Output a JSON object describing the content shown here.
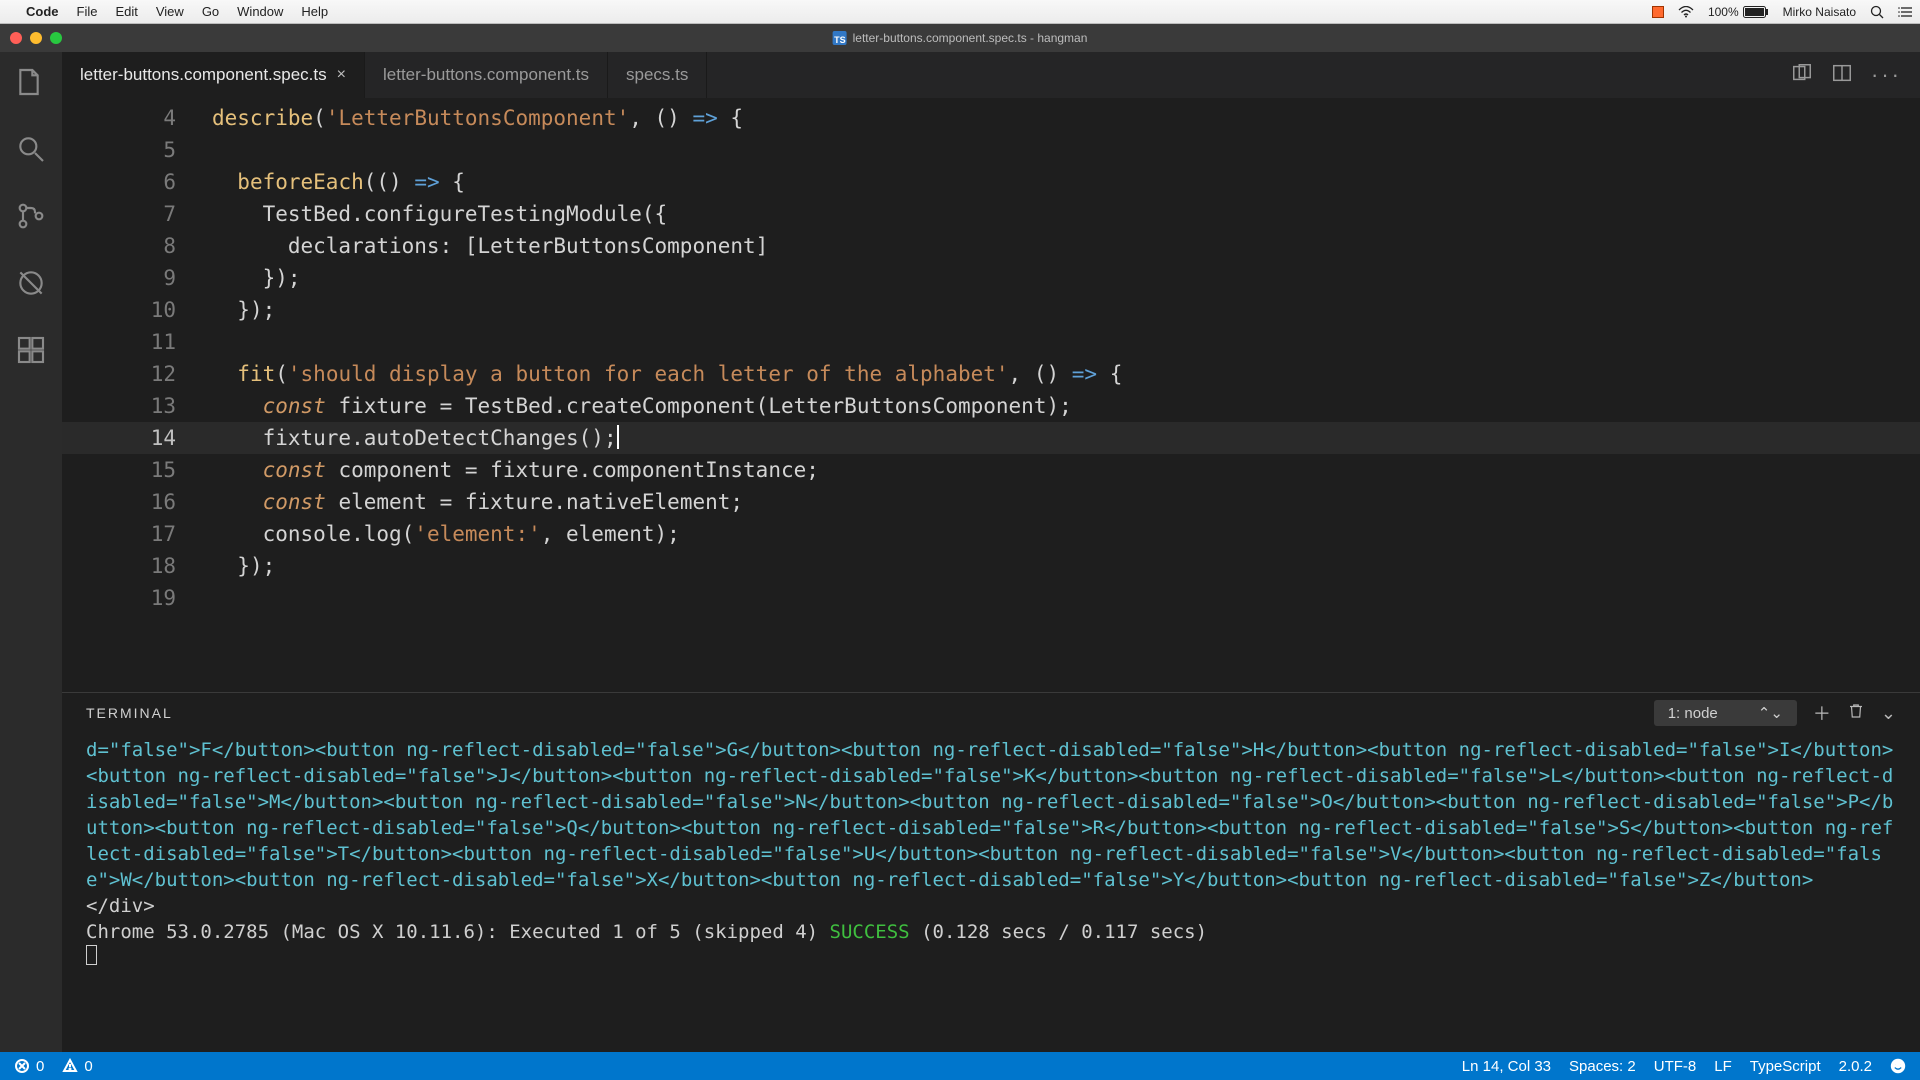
{
  "mac_menu": {
    "app": "Code",
    "items": [
      "File",
      "Edit",
      "View",
      "Go",
      "Window",
      "Help"
    ],
    "battery": "100%",
    "user": "Mirko Naisato"
  },
  "window_title": "letter-buttons.component.spec.ts - hangman",
  "tabs": [
    {
      "label": "letter-buttons.component.spec.ts",
      "active": true,
      "dirty": false
    },
    {
      "label": "letter-buttons.component.ts",
      "active": false
    },
    {
      "label": "specs.ts",
      "active": false
    }
  ],
  "code_lines": [
    {
      "n": 4,
      "html": "<span class='tok-fn'>describe</span><span class='tok-punc'>(</span><span class='tok-str'>'LetterButtonsComponent'</span><span class='tok-punc'>, () </span><span class='tok-arrow'>=&gt;</span><span class='tok-punc'> {</span>"
    },
    {
      "n": 5,
      "html": ""
    },
    {
      "n": 6,
      "html": "  <span class='tok-fn'>beforeEach</span><span class='tok-punc'>(() </span><span class='tok-arrow'>=&gt;</span><span class='tok-punc'> {</span>"
    },
    {
      "n": 7,
      "html": "    <span class='tok-id'>TestBed.configureTestingModule({</span>"
    },
    {
      "n": 8,
      "html": "      <span class='tok-id'>declarations: [LetterButtonsComponent]</span>"
    },
    {
      "n": 9,
      "html": "    <span class='tok-punc'>});</span>"
    },
    {
      "n": 10,
      "html": "  <span class='tok-punc'>});</span>"
    },
    {
      "n": 11,
      "html": ""
    },
    {
      "n": 12,
      "html": "  <span class='tok-fn'>fit</span><span class='tok-punc'>(</span><span class='tok-str'>'should display a button for each letter of the alphabet'</span><span class='tok-punc'>, () </span><span class='tok-arrow'>=&gt;</span><span class='tok-punc'> {</span>"
    },
    {
      "n": 13,
      "html": "    <span class='tok-kw'>const</span> <span class='tok-id'>fixture = TestBed.createComponent(LetterButtonsComponent);</span>"
    },
    {
      "n": 14,
      "html": "    <span class='tok-id'>fixture.autoDetectChanges();</span>",
      "hl": true,
      "cursor": true
    },
    {
      "n": 15,
      "html": "    <span class='tok-kw'>const</span> <span class='tok-id'>component = fixture.componentInstance;</span>"
    },
    {
      "n": 16,
      "html": "    <span class='tok-kw'>const</span> <span class='tok-id'>element = fixture.nativeElement;</span>"
    },
    {
      "n": 17,
      "html": "    <span class='tok-id'>console.log(</span><span class='tok-str'>'element:'</span><span class='tok-id'>, element);</span>"
    },
    {
      "n": 18,
      "html": "  <span class='tok-punc'>});</span>"
    },
    {
      "n": 19,
      "html": ""
    }
  ],
  "panel": {
    "title": "TERMINAL",
    "select": "1: node",
    "output_html": "d=\"false\"&gt;F&lt;/button&gt;&lt;button ng-reflect-disabled=\"false\"&gt;G&lt;/button&gt;&lt;button ng-reflect-disabled=\"false\"&gt;H&lt;/button&gt;&lt;button ng-reflect-disabled=\"false\"&gt;I&lt;/button&gt;&lt;button ng-reflect-disabled=\"false\"&gt;J&lt;/button&gt;&lt;button ng-reflect-disabled=\"false\"&gt;K&lt;/button&gt;&lt;button ng-reflect-disabled=\"false\"&gt;L&lt;/button&gt;&lt;button ng-reflect-disabled=\"false\"&gt;M&lt;/button&gt;&lt;button ng-reflect-disabled=\"false\"&gt;N&lt;/button&gt;&lt;button ng-reflect-disabled=\"false\"&gt;O&lt;/button&gt;&lt;button ng-reflect-disabled=\"false\"&gt;P&lt;/button&gt;&lt;button ng-reflect-disabled=\"false\"&gt;Q&lt;/button&gt;&lt;button ng-reflect-disabled=\"false\"&gt;R&lt;/button&gt;&lt;button ng-reflect-disabled=\"false\"&gt;S&lt;/button&gt;&lt;button ng-reflect-disabled=\"false\"&gt;T&lt;/button&gt;&lt;button ng-reflect-disabled=\"false\"&gt;U&lt;/button&gt;&lt;button ng-reflect-disabled=\"false\"&gt;V&lt;/button&gt;&lt;button ng-reflect-disabled=\"false\"&gt;W&lt;/button&gt;&lt;button ng-reflect-disabled=\"false\"&gt;X&lt;/button&gt;&lt;button ng-reflect-disabled=\"false\"&gt;Y&lt;/button&gt;&lt;button ng-reflect-disabled=\"false\"&gt;Z&lt;/button&gt;",
    "closing_div": "  </div>",
    "summary_pre": "Chrome 53.0.2785 (Mac OS X 10.11.6): Executed 1 of 5 (skipped 4) ",
    "summary_status": "SUCCESS",
    "summary_post": " (0.128 secs / 0.117 secs)"
  },
  "status": {
    "errors": "0",
    "warnings": "0",
    "ln_col": "Ln 14, Col 33",
    "spaces": "Spaces: 2",
    "encoding": "UTF-8",
    "eol": "LF",
    "lang": "TypeScript",
    "version": "2.0.2"
  }
}
